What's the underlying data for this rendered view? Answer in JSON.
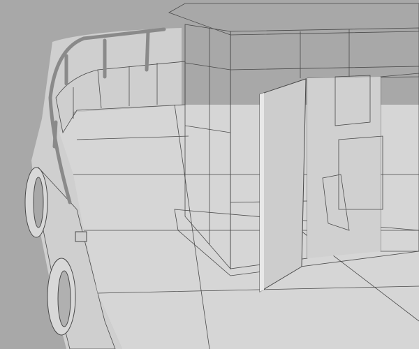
{
  "scene": {
    "subject": "boat-deck-3d-wireframe",
    "colors": {
      "background": "#a8a8a8",
      "surface": "#d4d4d4",
      "surface_light": "#e2e2e2",
      "surface_shadow": "#b8b4b4",
      "wire": "#4a4a4a"
    }
  }
}
